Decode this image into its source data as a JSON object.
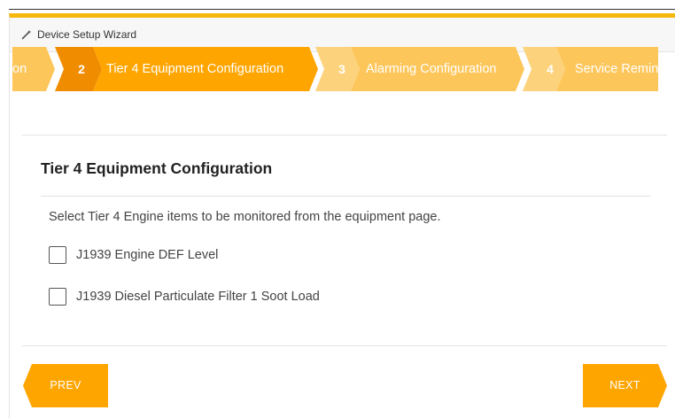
{
  "header": {
    "title": "Device Setup Wizard",
    "icon": "magic-wand-icon"
  },
  "steps": [
    {
      "number": "",
      "label": "on",
      "state": "completed"
    },
    {
      "number": "2",
      "label": "Tier 4 Equipment Configuration",
      "state": "active"
    },
    {
      "number": "3",
      "label": "Alarming Configuration",
      "state": "upcoming"
    },
    {
      "number": "4",
      "label": "Service Reminders",
      "state": "upcoming"
    }
  ],
  "content": {
    "title": "Tier 4 Equipment Configuration",
    "description": "Select Tier 4 Engine items to be monitored from the equipment page.",
    "options": [
      {
        "label": "J1939 Engine DEF Level",
        "checked": false
      },
      {
        "label": "J1939 Diesel Particulate Filter 1 Soot Load",
        "checked": false
      }
    ]
  },
  "footer": {
    "prev_label": "PREV",
    "next_label": "NEXT"
  },
  "colors": {
    "accent": "#f5b80f",
    "active_number": "#f08c00",
    "active_body": "#ffa500",
    "upcoming_number": "#fcd37c",
    "upcoming_body": "#fdc65a"
  }
}
